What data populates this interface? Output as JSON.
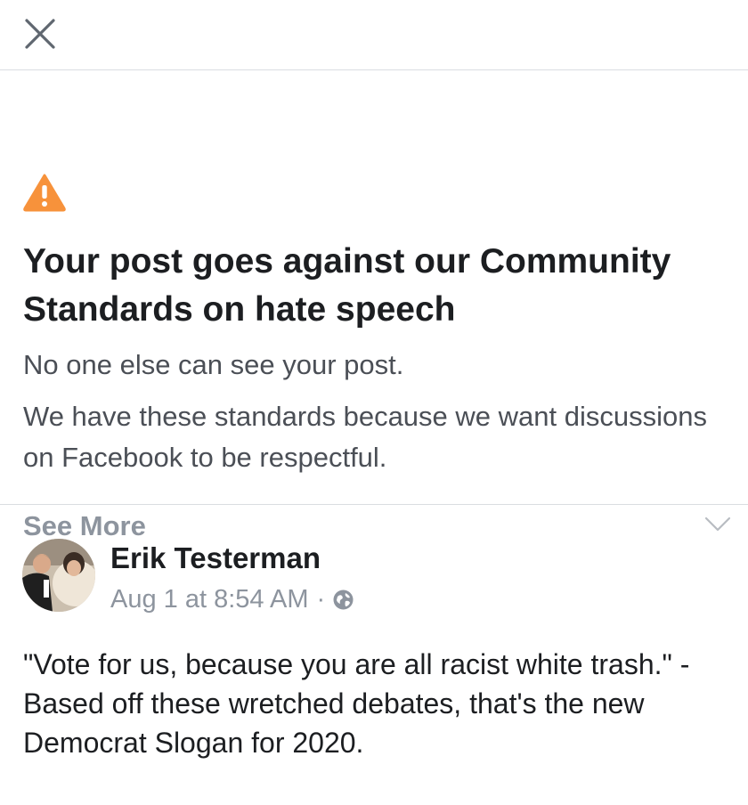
{
  "header": {
    "close_icon": "close-icon"
  },
  "notice": {
    "icon": "warning-icon",
    "icon_color": "#f7923b",
    "title": "Your post goes against our Community Standards on hate speech",
    "line1": "No one else can see your post.",
    "line2": "We have these standards because we want discussions on Facebook to be respectful.",
    "see_more": "See More",
    "expand_icon": "chevron-down-icon"
  },
  "post": {
    "author": "Erik Testerman",
    "timestamp": "Aug 1 at 8:54 AM",
    "separator": "·",
    "privacy_icon": "globe-icon",
    "text": "\"Vote for us, because you are all racist white trash.\" - Based off these wretched debates, that's the new Democrat Slogan for 2020."
  },
  "colors": {
    "primary_text": "#1c1e21",
    "secondary_text": "#4b4f56",
    "muted_text": "#8d949e",
    "divider": "#dadde1"
  }
}
